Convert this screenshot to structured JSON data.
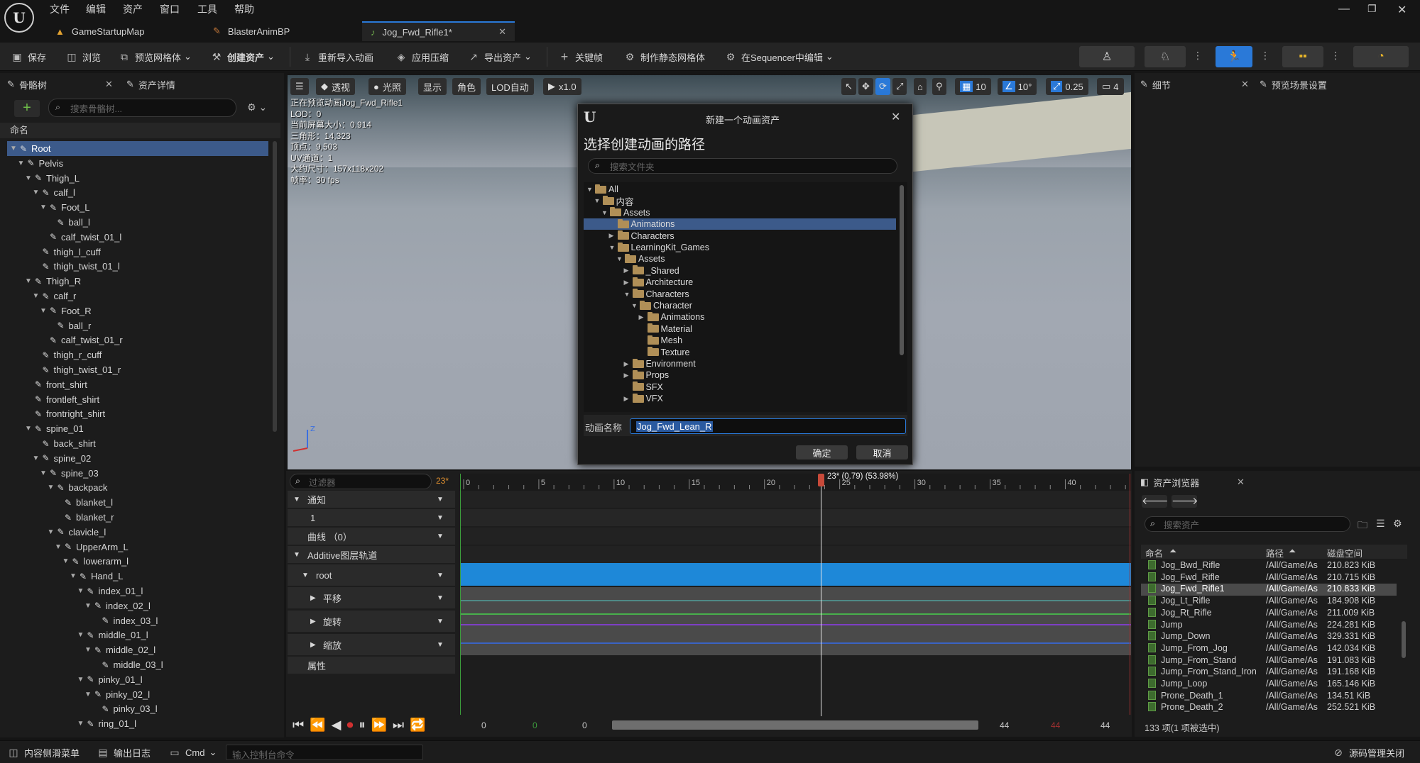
{
  "menu": [
    "文件",
    "编辑",
    "资产",
    "窗口",
    "工具",
    "帮助"
  ],
  "tabs": [
    "GameStartupMap",
    "BlasterAnimBP",
    "Jog_Fwd_Rifle1*"
  ],
  "toolbar": {
    "save": "保存",
    "browse": "浏览",
    "preview_mesh": "预览网格体",
    "create_asset": "创建资产",
    "reimport": "重新导入动画",
    "apply_compression": "应用压缩",
    "export_asset": "导出资产",
    "keyframe": "关键帧",
    "make_static_mesh": "制作静态网格体",
    "edit_in_sequencer": "在Sequencer中编辑"
  },
  "skeleton_tree": {
    "tab_title": "骨骼树",
    "tab2_title": "资产详情",
    "search_placeholder": "搜索骨骼树...",
    "column_header": "命名",
    "bones": [
      "Root",
      "Pelvis",
      "Thigh_L",
      "calf_l",
      "Foot_L",
      "ball_l",
      "calf_twist_01_l",
      "thigh_l_cuff",
      "thigh_twist_01_l",
      "Thigh_R",
      "calf_r",
      "Foot_R",
      "ball_r",
      "calf_twist_01_r",
      "thigh_r_cuff",
      "thigh_twist_01_r",
      "front_shirt",
      "frontleft_shirt",
      "frontright_shirt",
      "spine_01",
      "back_shirt",
      "spine_02",
      "spine_03",
      "backpack",
      "blanket_l",
      "blanket_r",
      "clavicle_l",
      "UpperArm_L",
      "lowerarm_l",
      "Hand_L",
      "index_01_l",
      "index_02_l",
      "index_03_l",
      "middle_01_l",
      "middle_02_l",
      "middle_03_l",
      "pinky_01_l",
      "pinky_02_l",
      "pinky_03_l",
      "ring_01_l"
    ]
  },
  "viewport": {
    "buttons": [
      "透视",
      "光照",
      "显示",
      "角色",
      "LOD自动",
      "x1.0"
    ],
    "right_values": [
      "10",
      "10°",
      "0.25",
      "4"
    ],
    "stats": [
      "正在预览动画Jog_Fwd_Rifle1",
      "LOD：0",
      "当前屏幕大小：0.914",
      "三角形：14,323",
      "顶点：9,503",
      "UV通道：1",
      "大约尺寸：157x118x202",
      "帧率：30 fps"
    ]
  },
  "dialog": {
    "title": "新建一个动画资产",
    "heading": "选择创建动画的路径",
    "search_placeholder": "搜索文件夹",
    "folders": [
      "All",
      "内容",
      "Assets",
      "Animations",
      "Characters",
      "LearningKit_Games",
      "Assets",
      "_Shared",
      "Architecture",
      "Characters",
      "Character",
      "Animations",
      "Material",
      "Mesh",
      "Texture",
      "Environment",
      "Props",
      "SFX",
      "VFX"
    ],
    "name_label": "动画名称",
    "name_value": "Jog_Fwd_Lean_R",
    "ok": "确定",
    "cancel": "取消"
  },
  "details": {
    "tab1": "细节",
    "tab2": "预览场景设置"
  },
  "sequencer": {
    "filter_placeholder": "过滤器",
    "frame_badge": "23*",
    "rows": [
      "通知",
      "1",
      "曲线 （0）",
      "Additive图层轨道",
      "root",
      "平移",
      "旋转",
      "缩放",
      "属性"
    ],
    "ruler_ticks": [
      "0",
      "5",
      "10",
      "15",
      "20",
      "25",
      "30",
      "35",
      "40"
    ],
    "playhead_label": "23* (0.79) (53.98%)",
    "bottom_values": [
      "0",
      "0",
      "0",
      "44",
      "44",
      "44"
    ]
  },
  "asset_browser": {
    "tab_title": "资产浏览器",
    "search_placeholder": "搜索资产",
    "columns": [
      "命名",
      "路径",
      "磁盘空间"
    ],
    "rows": [
      {
        "name": "Jog_Bwd_Rifle",
        "path": "/All/Game/As",
        "size": "210.823 KiB"
      },
      {
        "name": "Jog_Fwd_Rifle",
        "path": "/All/Game/As",
        "size": "210.715 KiB"
      },
      {
        "name": "Jog_Fwd_Rifle1",
        "path": "/All/Game/As",
        "size": "210.833 KiB"
      },
      {
        "name": "Jog_Lt_Rifle",
        "path": "/All/Game/As",
        "size": "184.908 KiB"
      },
      {
        "name": "Jog_Rt_Rifle",
        "path": "/All/Game/As",
        "size": "211.009 KiB"
      },
      {
        "name": "Jump",
        "path": "/All/Game/As",
        "size": "224.281 KiB"
      },
      {
        "name": "Jump_Down",
        "path": "/All/Game/As",
        "size": "329.331 KiB"
      },
      {
        "name": "Jump_From_Jog",
        "path": "/All/Game/As",
        "size": "142.034 KiB"
      },
      {
        "name": "Jump_From_Stand",
        "path": "/All/Game/As",
        "size": "191.083 KiB"
      },
      {
        "name": "Jump_From_Stand_Iron",
        "path": "/All/Game/As",
        "size": "191.168 KiB"
      },
      {
        "name": "Jump_Loop",
        "path": "/All/Game/As",
        "size": "165.146 KiB"
      },
      {
        "name": "Prone_Death_1",
        "path": "/All/Game/As",
        "size": "134.51 KiB"
      },
      {
        "name": "Prone_Death_2",
        "path": "/All/Game/As",
        "size": "252.521 KiB"
      }
    ],
    "count": "133 项(1 项被选中)"
  },
  "statusbar": {
    "content_drawer": "内容侧滑菜单",
    "output_log": "输出日志",
    "cmd": "Cmd",
    "console_placeholder": "输入控制台命令",
    "source_control": "源码管理关闭"
  }
}
